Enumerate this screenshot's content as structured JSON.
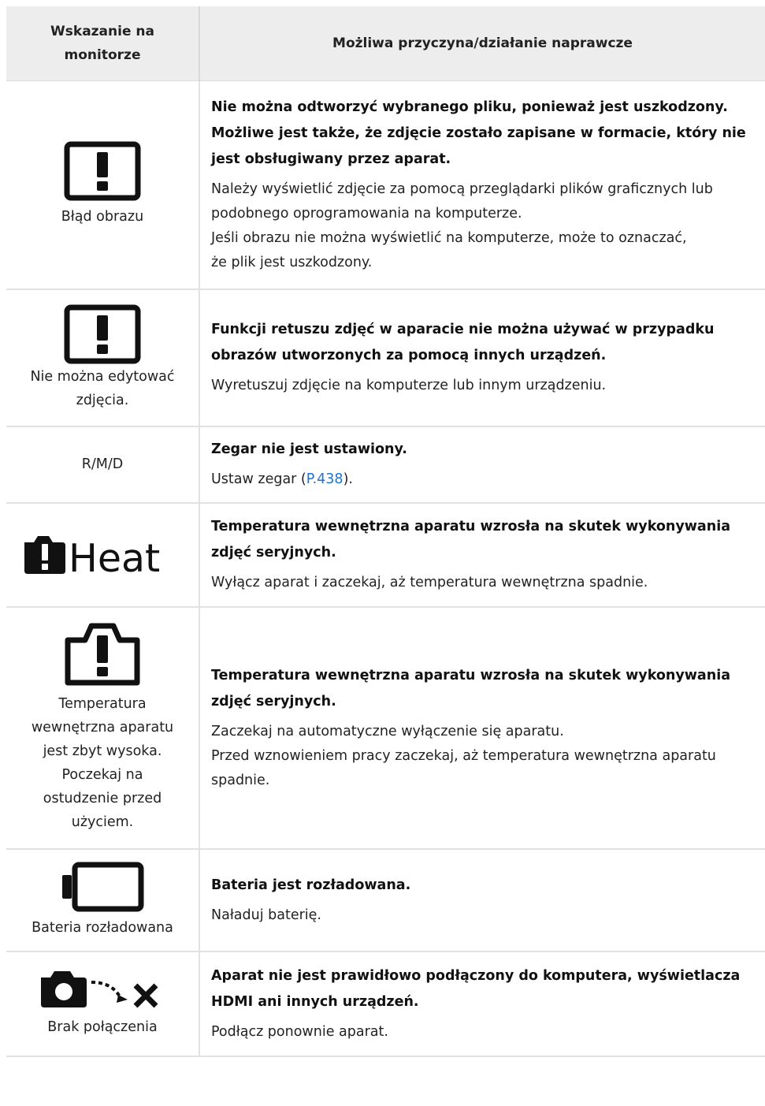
{
  "header": {
    "col1": "Wskazanie na monitorze",
    "col1_line1": "Wskazanie na",
    "col1_line2": "monitorze",
    "col2": "Możliwa przyczyna/działanie naprawcze"
  },
  "rows": [
    {
      "icon": "warning-screen-icon",
      "label": "Błąd obrazu",
      "label_lines": [
        "Błąd obrazu"
      ],
      "cause_lines": [
        "Nie można odtworzyć wybranego pliku, ponieważ jest uszkodzony.",
        "Możliwe jest także, że zdjęcie zostało zapisane w formacie, który nie",
        "jest obsługiwany przez aparat."
      ],
      "action_lines": [
        "Należy wyświetlić zdjęcie za pomocą przeglądarki plików graficznych lub",
        "podobnego oprogramowania na komputerze.",
        "Jeśli obrazu nie można wyświetlić na komputerze, może to oznaczać,",
        "że plik jest uszkodzony."
      ]
    },
    {
      "icon": "warning-screen-icon",
      "label": "Nie można edytować zdjęcia.",
      "label_lines": [
        "Nie można edytować",
        "zdjęcia."
      ],
      "cause_lines": [
        "Funkcji retuszu zdjęć w aparacie nie można używać w przypadku",
        "obrazów utworzonych za pomocą innych urządzeń."
      ],
      "action_lines": [
        "Wyretuszuj zdjęcie na komputerze lub innym urządzeniu."
      ]
    },
    {
      "icon": "",
      "label": "R/M/D",
      "label_lines": [
        "R/M/D"
      ],
      "cause_lines": [
        "Zegar nie jest ustawiony."
      ],
      "action_prefix": "Ustaw zegar (",
      "action_link": "P.438",
      "action_suffix": ")."
    },
    {
      "icon": "heat-warning-icon",
      "icon_text": "Heat",
      "label": "",
      "cause_lines": [
        "Temperatura wewnętrzna aparatu wzrosła na skutek wykonywania",
        "zdjęć seryjnych."
      ],
      "action_lines": [
        "Wyłącz aparat i zaczekaj, aż temperatura wewnętrzna spadnie."
      ]
    },
    {
      "icon": "camera-warning-icon",
      "label": "Temperatura wewnętrzna aparatu jest zbyt wysoka. Poczekaj na ostudzenie przed użyciem.",
      "label_lines": [
        "Temperatura",
        "wewnętrzna aparatu",
        "jest zbyt wysoka.",
        "Poczekaj na",
        "ostudzenie przed",
        "użyciem."
      ],
      "cause_lines": [
        "Temperatura wewnętrzna aparatu wzrosła na skutek wykonywania",
        "zdjęć seryjnych."
      ],
      "action_lines": [
        "Zaczekaj na automatyczne wyłączenie się aparatu.",
        "Przed wznowieniem pracy zaczekaj, aż temperatura wewnętrzna aparatu",
        "spadnie."
      ]
    },
    {
      "icon": "empty-battery-icon",
      "label": "Bateria rozładowana",
      "label_lines": [
        "Bateria rozładowana"
      ],
      "cause_lines": [
        "Bateria jest rozładowana."
      ],
      "action_lines": [
        "Naładuj baterię."
      ]
    },
    {
      "icon": "camera-no-connection-icon",
      "label": "Brak połączenia",
      "label_lines": [
        "Brak połączenia"
      ],
      "cause_lines": [
        "Aparat nie jest prawidłowo podłączony do komputera, wyświetlacza",
        "HDMI ani innych urządzeń."
      ],
      "action_lines": [
        "Podłącz ponownie aparat."
      ]
    }
  ]
}
